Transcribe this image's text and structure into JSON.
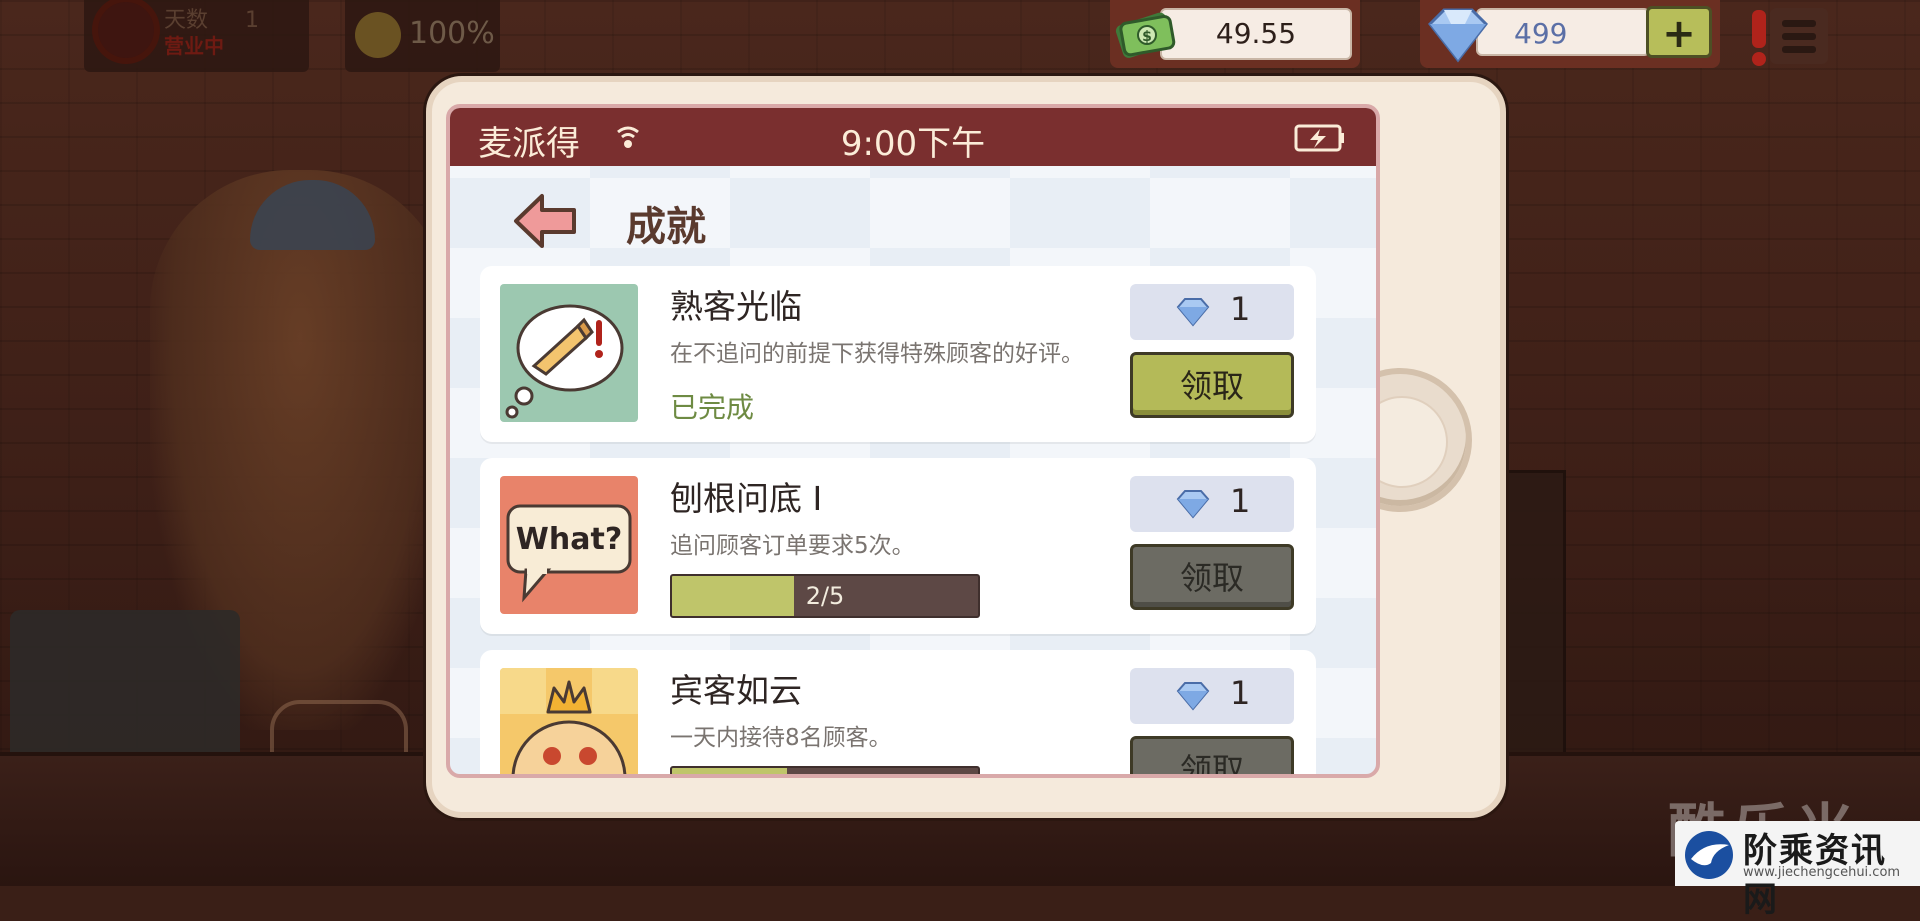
{
  "hud": {
    "day_label": "天数",
    "day_number": "1",
    "day_subtext": "营业中",
    "mood_percent": "100%",
    "money": "49.55",
    "gems": "499",
    "add_gems_label": "+"
  },
  "tablet": {
    "carrier": "麦派得",
    "time": "9:00下午",
    "page_title": "成就"
  },
  "achievements": [
    {
      "title": "熟客光临",
      "description": "在不追问的前提下获得特殊顾客的好评。",
      "status": "已完成",
      "reward": "1",
      "claim_label": "领取",
      "claimable": true,
      "icon": "pizza-thought-icon"
    },
    {
      "title": "刨根问底 Ⅰ",
      "description": "追问顾客订单要求5次。",
      "progress_text": "2/5",
      "progress": 0.4,
      "reward": "1",
      "claim_label": "领取",
      "claimable": false,
      "icon": "what-speech-bubble-icon",
      "icon_text": "What?"
    },
    {
      "title": "宾客如云",
      "description": "一天内接待8名顾客。",
      "progress": 0.375,
      "reward": "1",
      "claim_label": "领取",
      "claimable": false,
      "icon": "crowned-pizza-icon"
    }
  ],
  "watermark": {
    "title": "阶乘资讯网",
    "url": "www.jiechengcehui.com",
    "faded_text": "酷乐米"
  },
  "colors": {
    "statusbar": "#7a2f2f",
    "claim_active": "#b4ba58",
    "claim_inactive": "#6c6b63",
    "progress_fill": "#bfc56a",
    "completed_text": "#6e8b43"
  }
}
